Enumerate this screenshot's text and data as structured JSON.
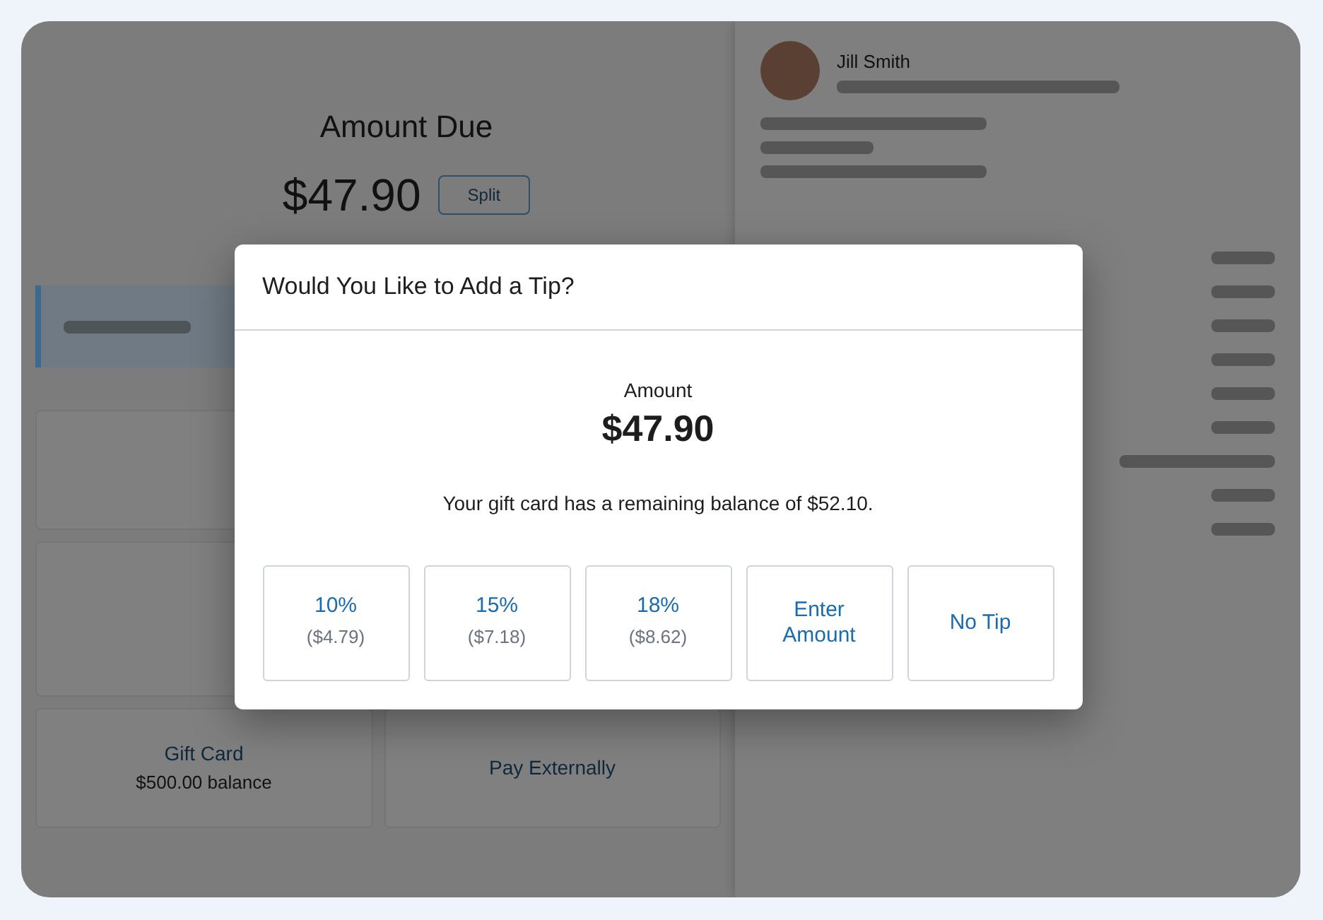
{
  "background": {
    "amount_label": "Amount Due",
    "amount": "$47.90",
    "split_button": "Split",
    "tiles": [
      {
        "label": "Gift Card",
        "detail": "$500.00 balance"
      },
      {
        "label": "Pay Externally"
      }
    ],
    "customer_name": "Jill Smith"
  },
  "dialog": {
    "title": "Would You Like to Add a Tip?",
    "amount_label": "Amount",
    "amount": "$47.90",
    "message": "Your gift card has a remaining balance of $52.10.",
    "options": [
      {
        "label": "10%",
        "detail": "($4.79)"
      },
      {
        "label": "15%",
        "detail": "($7.18)"
      },
      {
        "label": "18%",
        "detail": "($8.62)"
      },
      {
        "label": "Enter Amount"
      },
      {
        "label": "No Tip"
      }
    ]
  }
}
